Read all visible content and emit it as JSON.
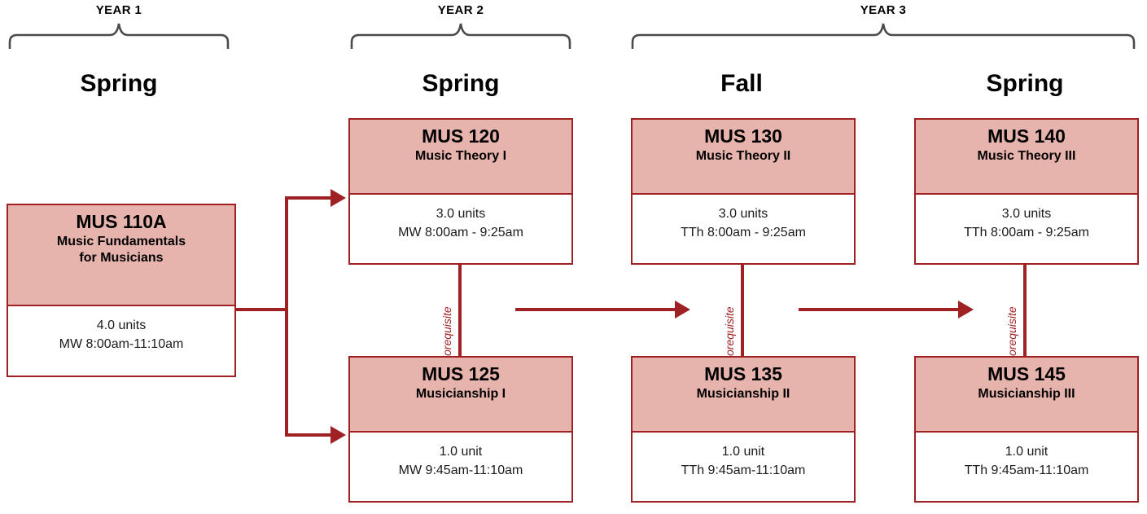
{
  "years": [
    {
      "label": "YEAR 1"
    },
    {
      "label": "YEAR 2"
    },
    {
      "label": "YEAR 3"
    }
  ],
  "terms": [
    {
      "label": "Spring"
    },
    {
      "label": "Spring"
    },
    {
      "label": "Fall"
    },
    {
      "label": "Spring"
    }
  ],
  "courses": {
    "mus110a": {
      "code": "MUS 110A",
      "title_line1": "Music Fundamentals",
      "title_line2": "for Musicians",
      "units": "4.0 units",
      "schedule": "MW 8:00am-11:10am"
    },
    "mus120": {
      "code": "MUS 120",
      "title_line1": "Music Theory I",
      "units": "3.0 units",
      "schedule": "MW 8:00am - 9:25am"
    },
    "mus130": {
      "code": "MUS 130",
      "title_line1": "Music Theory II",
      "units": "3.0 units",
      "schedule": "TTh 8:00am - 9:25am"
    },
    "mus140": {
      "code": "MUS 140",
      "title_line1": "Music Theory III",
      "units": "3.0 units",
      "schedule": "TTh 8:00am - 9:25am"
    },
    "mus125": {
      "code": "MUS 125",
      "title_line1": "Musicianship I",
      "units": "1.0 unit",
      "schedule": "MW 9:45am-11:10am"
    },
    "mus135": {
      "code": "MUS 135",
      "title_line1": "Musicianship II",
      "units": "1.0 unit",
      "schedule": "TTh 9:45am-11:10am"
    },
    "mus145": {
      "code": "MUS 145",
      "title_line1": "Musicianship III",
      "units": "1.0 unit",
      "schedule": "TTh 9:45am-11:10am"
    }
  },
  "connectors": {
    "corequisite_label_1": "corequisite",
    "corequisite_label_2": "corequisite",
    "corequisite_label_3": "corequisite"
  },
  "colors": {
    "box_fill": "#e7b4ad",
    "box_border": "#9f2123",
    "arrow": "#9f2123",
    "brace": "#4a4a4a",
    "text": "#000000"
  }
}
